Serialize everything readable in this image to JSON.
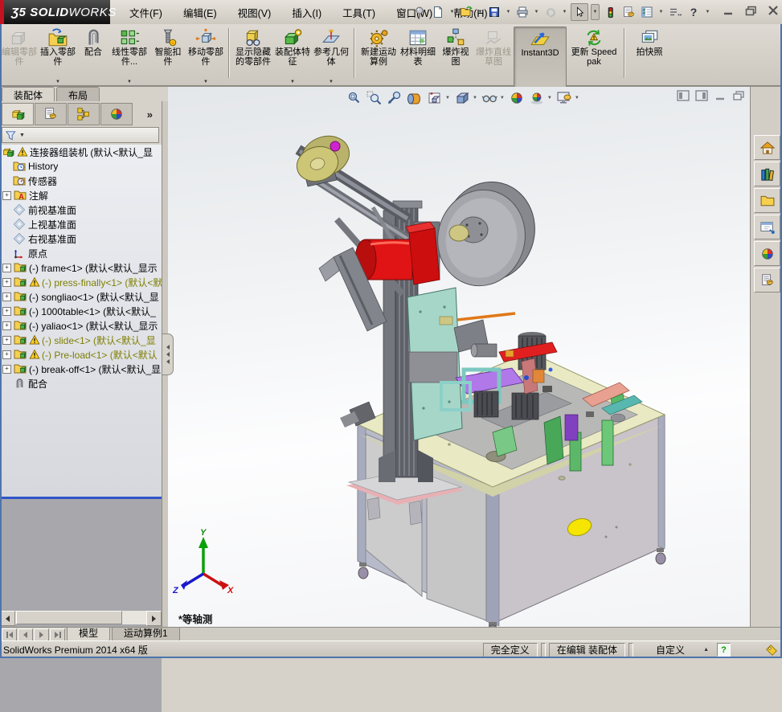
{
  "title_bar": {
    "logo_prefix": "Ʒ5",
    "logo_bold": "SOLID",
    "logo_light": "WORKS",
    "menus": [
      "文件(F)",
      "编辑(E)",
      "视图(V)",
      "插入(I)",
      "工具(T)",
      "窗口(W)",
      "帮助(H)"
    ]
  },
  "command_bar": {
    "buttons": [
      {
        "label": "编辑零部件"
      },
      {
        "label": "插入零部件"
      },
      {
        "label": "配合"
      },
      {
        "label": "线性零部件..."
      },
      {
        "label": "智能扣件"
      },
      {
        "label": "移动零部件"
      },
      {
        "label": "显示隐藏的零部件"
      },
      {
        "label": "装配体特征"
      },
      {
        "label": "参考几何体"
      },
      {
        "label": "新建运动算例"
      },
      {
        "label": "材料明细表"
      },
      {
        "label": "爆炸视图"
      },
      {
        "label": "爆炸直线草图"
      },
      {
        "label": "Instant3D"
      },
      {
        "label": "更新 Speedpak"
      },
      {
        "label": "拍快照"
      }
    ]
  },
  "panel": {
    "tabs": [
      "装配体",
      "布局"
    ],
    "chevron": "»",
    "tree": {
      "items": [
        {
          "label": "连接器组装机 (默认<默认_显"
        },
        {
          "label": "History"
        },
        {
          "label": "传感器"
        },
        {
          "label": "注解"
        },
        {
          "label": "前视基准面"
        },
        {
          "label": "上视基准面"
        },
        {
          "label": "右视基准面"
        },
        {
          "label": "原点"
        },
        {
          "label": "(-) frame<1> (默认<默认_显示"
        },
        {
          "label": "(-) press-finally<1> (默认<默"
        },
        {
          "label": "(-) songliao<1> (默认<默认_显"
        },
        {
          "label": "(-) 1000table<1> (默认<默认_"
        },
        {
          "label": "(-) yaliao<1> (默认<默认_显示"
        },
        {
          "label": "(-) slide<1> (默认<默认_显"
        },
        {
          "label": "(-) Pre-load<1> (默认<默认"
        },
        {
          "label": "(-) break-off<1> (默认<默认_显"
        },
        {
          "label": "配合"
        }
      ]
    }
  },
  "viewport": {
    "view_label": "*等轴测",
    "triad": {
      "x": "X",
      "y": "Y",
      "z": "Z"
    }
  },
  "bottom_bar": {
    "tabs": [
      "模型",
      "运动算例1"
    ]
  },
  "status_bar": {
    "product": "SolidWorks Premium 2014 x64 版",
    "define_state": "完全定义",
    "edit_state": "在编辑 装配体",
    "units": "自定义",
    "help": "?"
  },
  "colors": {
    "logo_red": "#c41220",
    "warning_yellow": "#ffd028",
    "olive_text": "#7e7e00",
    "tree_divider_blue": "#2f55c8",
    "table_top": "#e9e9c4",
    "motor_red": "#e01414",
    "highlight_yellow_sticker": "#f5e500"
  }
}
